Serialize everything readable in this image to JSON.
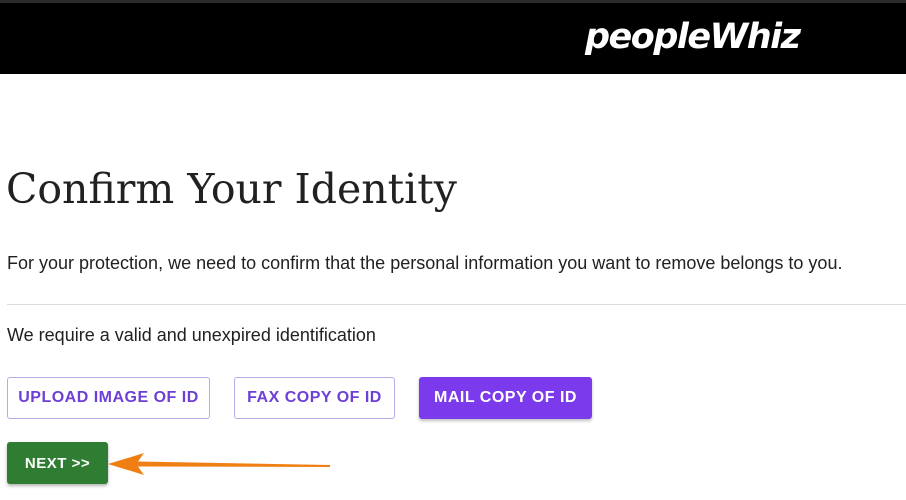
{
  "header": {
    "logo_text": "peopleWhiz",
    "background_color": "#000000"
  },
  "main": {
    "title": "Confirm Your Identity",
    "subtitle": "For your protection, we need to confirm that the personal information you want to remove belongs to you.",
    "requirement_text": "We require a valid and unexpired identification"
  },
  "options": {
    "upload_label": "UPLOAD IMAGE OF ID",
    "fax_label": "FAX COPY OF ID",
    "mail_label": "MAIL COPY OF ID",
    "selected": "MAIL COPY OF ID",
    "accent_color": "#7c3aed"
  },
  "actions": {
    "next_label": "NEXT >>",
    "next_color": "#2e7d32"
  },
  "annotation": {
    "arrow_icon": "arrow-left-icon",
    "arrow_color": "#f07f13"
  }
}
